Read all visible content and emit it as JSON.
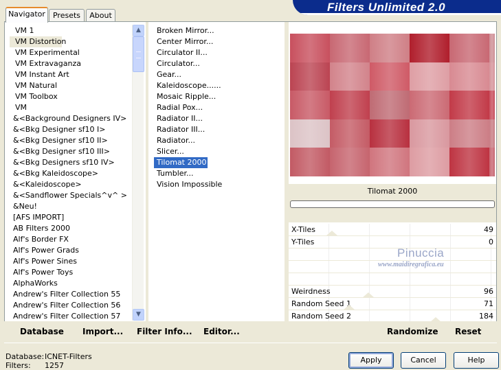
{
  "banner": {
    "title": "Filters Unlimited 2.0"
  },
  "tabs": [
    {
      "label": "Navigator",
      "active": true
    },
    {
      "label": "Presets",
      "active": false
    },
    {
      "label": "About",
      "active": false
    }
  ],
  "categories": [
    "VM 1",
    "VM Distortion",
    "VM Experimental",
    "VM Extravaganza",
    "VM Instant Art",
    "VM Natural",
    "VM Toolbox",
    "VM",
    "&<Background Designers IV>",
    "&<Bkg Designer sf10 I>",
    "&<Bkg Designer sf10 II>",
    "&<Bkg Designer sf10 III>",
    "&<Bkg Designers sf10 IV>",
    "&<Bkg Kaleidoscope>",
    "&<Kaleidoscope>",
    "&<Sandflower Specials^v^ >",
    "&Neu!",
    "[AFS IMPORT]",
    "AB Filters 2000",
    "Alf's Border FX",
    "Alf's Power Grads",
    "Alf's Power Sines",
    "Alf's Power Toys",
    "AlphaWorks",
    "Andrew's Filter Collection 55",
    "Andrew's Filter Collection 56",
    "Andrew's Filter Collection 57"
  ],
  "selected_category": "VM Distortion",
  "filters": [
    "Broken Mirror...",
    "Center Mirror...",
    "Circulator II...",
    "Circulator...",
    "Gear...",
    "Kaleidoscope......",
    "Mosaic Ripple...",
    "Radial Pox...",
    "Radiator II...",
    "Radiator III...",
    "Radiator...",
    "Slicer...",
    "Tilomat 2000",
    "Tumbler...",
    "Vision Impossible"
  ],
  "selected_filter": "Tilomat 2000",
  "filter_name": "Tilomat 2000",
  "preview_colors": [
    [
      "#c8505e",
      "#c86873",
      "#cf7f86",
      "#b01e2c",
      "#c86873",
      "#cf8f96"
    ],
    [
      "#bb4452",
      "#d2838b",
      "#cf5a66",
      "#de9ea4",
      "#d88a92",
      "#d6949b"
    ],
    [
      "#c85a66",
      "#c0404e",
      "#bf6b74",
      "#cb6a74",
      "#c23a48",
      "#c8505e"
    ],
    [
      "#dcc3c6",
      "#c45b65",
      "#b8303f",
      "#d9989f",
      "#cc7e86",
      "#c87d85"
    ],
    [
      "#c25a64",
      "#c6646e",
      "#d0757e",
      "#dd9ca2",
      "#be3442",
      "#c86873"
    ]
  ],
  "params": [
    {
      "label": "X-Tiles",
      "value": "49"
    },
    {
      "label": "Y-Tiles",
      "value": "0"
    },
    {
      "label": "",
      "value": ""
    },
    {
      "label": "",
      "value": ""
    },
    {
      "label": "",
      "value": ""
    },
    {
      "label": "Weirdness",
      "value": "96"
    },
    {
      "label": "Random Seed 1",
      "value": "71"
    },
    {
      "label": "Random Seed 2",
      "value": "184"
    }
  ],
  "watermark": {
    "line1": "Pinuccia",
    "line2": "www.maidiregrafica.eu"
  },
  "bottom_links": {
    "database": "Database",
    "import": "Import...",
    "filter_info": "Filter Info...",
    "editor": "Editor...",
    "randomize": "Randomize",
    "reset": "Reset"
  },
  "status": {
    "database_label": "Database:",
    "database_value": "ICNET-Filters",
    "filters_label": "Filters:",
    "filters_value": "1257"
  },
  "buttons": {
    "apply": "Apply",
    "cancel": "Cancel",
    "help": "Help"
  },
  "scrollbar": {
    "up_glyph": "▲",
    "down_glyph": "▼"
  }
}
